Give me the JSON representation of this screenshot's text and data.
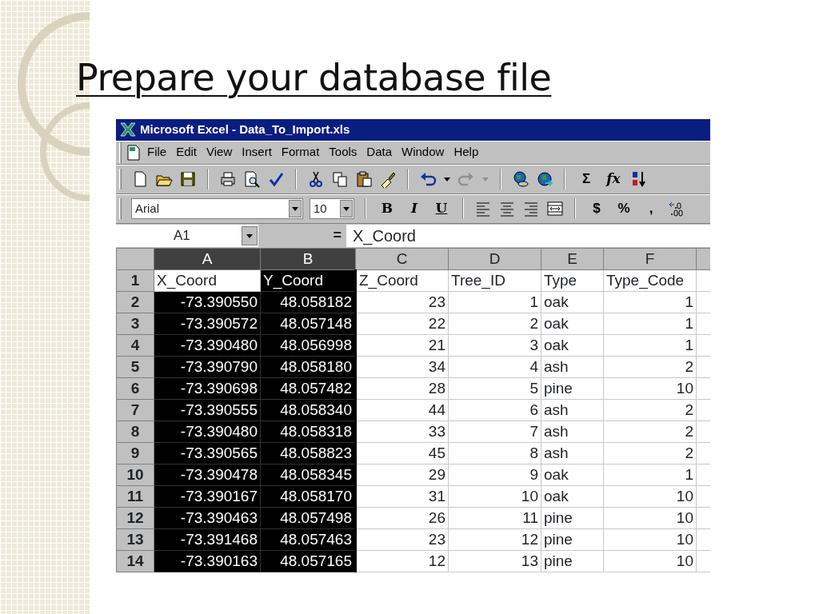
{
  "slide_title": "Prepare your database file",
  "window": {
    "title": "Microsoft Excel - Data_To_Import.xls"
  },
  "menu": [
    "File",
    "Edit",
    "View",
    "Insert",
    "Format",
    "Tools",
    "Data",
    "Window",
    "Help"
  ],
  "standard_toolbar": {
    "sum": "Σ",
    "function": "fx"
  },
  "formatting_toolbar": {
    "font": "Arial",
    "size": "10",
    "bold": "B",
    "italic": "I",
    "underline": "U",
    "currency": "$",
    "percent": "%",
    "comma": ","
  },
  "formula_bar": {
    "name_box": "A1",
    "equals": "=",
    "content": "X_Coord"
  },
  "columns": [
    {
      "label": "A",
      "selected": true
    },
    {
      "label": "B",
      "selected": true
    },
    {
      "label": "C",
      "selected": false
    },
    {
      "label": "D",
      "selected": false
    },
    {
      "label": "E",
      "selected": false
    },
    {
      "label": "F",
      "selected": false
    }
  ],
  "rows": [
    {
      "header": "1",
      "cells": [
        "X_Coord",
        "Y_Coord",
        "Z_Coord",
        "Tree_ID",
        "Type",
        "Type_Code"
      ]
    },
    {
      "header": "2",
      "cells": [
        "-73.390550",
        "48.058182",
        "23",
        "1",
        "oak",
        "1"
      ]
    },
    {
      "header": "3",
      "cells": [
        "-73.390572",
        "48.057148",
        "22",
        "2",
        "oak",
        "1"
      ]
    },
    {
      "header": "4",
      "cells": [
        "-73.390480",
        "48.056998",
        "21",
        "3",
        "oak",
        "1"
      ]
    },
    {
      "header": "5",
      "cells": [
        "-73.390790",
        "48.058180",
        "34",
        "4",
        "ash",
        "2"
      ]
    },
    {
      "header": "6",
      "cells": [
        "-73.390698",
        "48.057482",
        "28",
        "5",
        "pine",
        "10"
      ]
    },
    {
      "header": "7",
      "cells": [
        "-73.390555",
        "48.058340",
        "44",
        "6",
        "ash",
        "2"
      ]
    },
    {
      "header": "8",
      "cells": [
        "-73.390480",
        "48.058318",
        "33",
        "7",
        "ash",
        "2"
      ]
    },
    {
      "header": "9",
      "cells": [
        "-73.390565",
        "48.058823",
        "45",
        "8",
        "ash",
        "2"
      ]
    },
    {
      "header": "10",
      "cells": [
        "-73.390478",
        "48.058345",
        "29",
        "9",
        "oak",
        "1"
      ]
    },
    {
      "header": "11",
      "cells": [
        "-73.390167",
        "48.058170",
        "31",
        "10",
        "oak",
        "10"
      ]
    },
    {
      "header": "12",
      "cells": [
        "-73.390463",
        "48.057498",
        "26",
        "11",
        "pine",
        "10"
      ]
    },
    {
      "header": "13",
      "cells": [
        "-73.391468",
        "48.057463",
        "23",
        "12",
        "pine",
        "10"
      ]
    },
    {
      "header": "14",
      "cells": [
        "-73.390163",
        "48.057165",
        "12",
        "13",
        "pine",
        "10"
      ]
    }
  ]
}
